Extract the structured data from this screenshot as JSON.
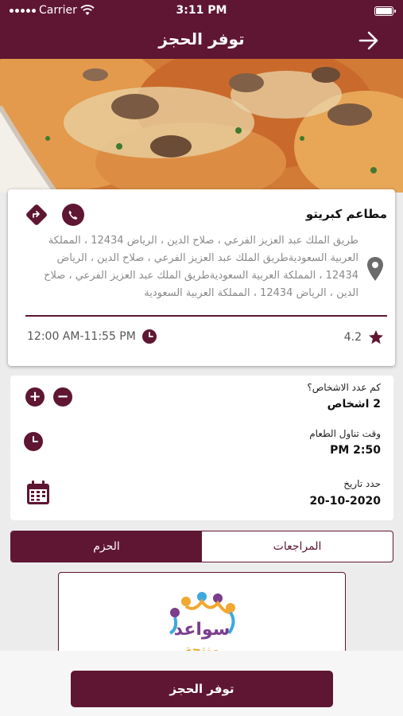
{
  "status_bar": {
    "carrier": "Carrier",
    "time": "3:11 PM"
  },
  "nav": {
    "title": "توفر الحجز",
    "back_icon": "arrow-right-icon"
  },
  "theme": {
    "primary": "#5f1632",
    "background": "#ececec"
  },
  "restaurant": {
    "name": "مطاعم كبريتو",
    "address": "طريق الملك عبد العزيز الفرعي ، صلاح الدين ، الرياض 12434 ، المملكة العربية السعوديةطريق الملك عبد العزيز الفرعي ، صلاح الدين ، الرياض 12434 ، المملكة العربية السعوديةطريق الملك عبد العزيز الفرعي ، صلاح الدين ، الرياض 12434 ، المملكة العربية السعودية",
    "hours": "12:00 AM-11:55 PM",
    "rating": "4.2"
  },
  "booking": {
    "guests_label": "كم عدد الاشخاص؟",
    "guests_value": "2 اشخاص",
    "plus": "+",
    "minus": "−",
    "time_label": "وقت تناول الطعام",
    "time_value": "2:50 PM",
    "date_label": "حدد تاريخ",
    "date_value": "20-10-2020"
  },
  "tabs": {
    "reviews": "المراجعات",
    "packages": "الحزم"
  },
  "package_logo": {
    "line1": "سواعد",
    "line2": "منتجة"
  },
  "book_button": "توفر الحجز"
}
